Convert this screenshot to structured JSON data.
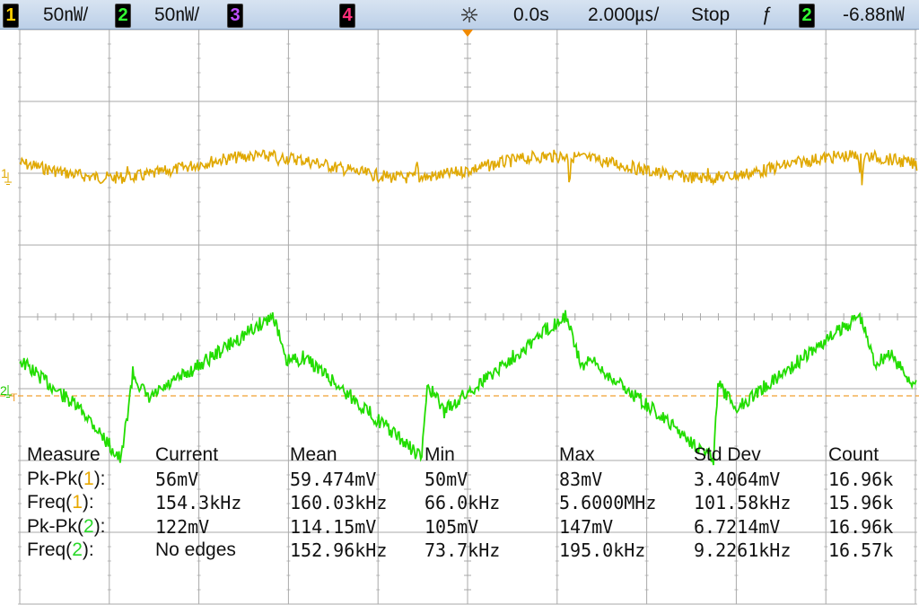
{
  "topbar": {
    "ch1": {
      "num": "1",
      "scale": "50㎻/"
    },
    "ch2": {
      "num": "2",
      "scale": "50㎻/"
    },
    "ch3": {
      "num": "3"
    },
    "ch4": {
      "num": "4"
    },
    "delay": "0.0s",
    "timebase": "2.000㎲/",
    "run_state": "Stop",
    "trigger_slope": "ƒ",
    "trigger_source": "2",
    "trigger_level": "-6.88㎻"
  },
  "markers": {
    "ch1": "1",
    "ch2": "2",
    "trigger": "T"
  },
  "colors": {
    "ch1": "#e0a800",
    "ch2": "#22dd00",
    "grid": "#a9a9a9",
    "trigger_line": "#f0a030"
  },
  "measurements": {
    "headers": [
      "Measure",
      "Current",
      "Mean",
      "Min",
      "Max",
      "Std Dev",
      "Count"
    ],
    "rows": [
      {
        "prefix": "Pk-Pk(",
        "ch": "1",
        "suffix": "):",
        "channel": 1,
        "values": [
          "56mV",
          "59.474mV",
          "50mV",
          "83mV",
          "3.4064mV",
          "16.96k"
        ]
      },
      {
        "prefix": "Freq(",
        "ch": "1",
        "suffix": "):",
        "channel": 1,
        "values": [
          "154.3kHz",
          "160.03kHz",
          "66.0kHz",
          "5.6000MHz",
          "101.58kHz",
          "15.96k"
        ]
      },
      {
        "prefix": "Pk-Pk(",
        "ch": "2",
        "suffix": "):",
        "channel": 2,
        "values": [
          "122mV",
          "114.15mV",
          "105mV",
          "147mV",
          "6.7214mV",
          "16.96k"
        ]
      },
      {
        "prefix": "Freq(",
        "ch": "2",
        "suffix": "):",
        "channel": 2,
        "values": [
          "No edges",
          "152.96kHz",
          "73.7kHz",
          "195.0kHz",
          "9.2261kHz",
          "16.57k"
        ]
      }
    ]
  }
}
